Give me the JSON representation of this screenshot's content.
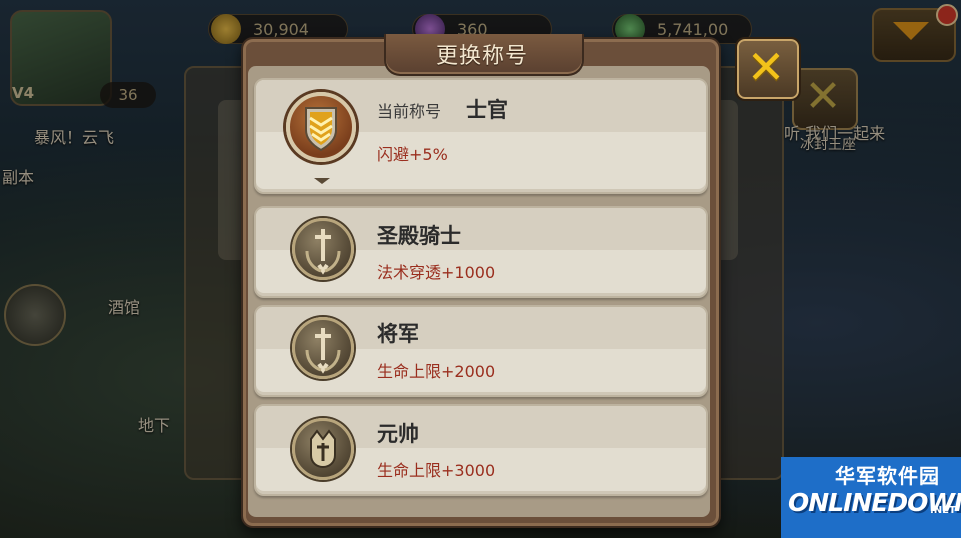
{
  "background": {
    "resources": [
      "30,904",
      "360",
      "5,741,00"
    ],
    "player_level": "V4",
    "player_count": "36",
    "player_name": "暴风！云飞",
    "side_label": "副本",
    "tavern_label": "酒馆",
    "dungeon_label": "地下",
    "banner_text": "听 我们一起来",
    "banner_text2": "冰封王座"
  },
  "dialog": {
    "title": "更换称号",
    "current": {
      "label": "当前称号",
      "name": "士官",
      "bonus": "闪避+5%",
      "emblem_icon": "sergeant-chevron-emblem"
    },
    "titles": [
      {
        "name": "圣殿骑士",
        "bonus": "法术穿透+1000",
        "emblem_icon": "sword-laurel-emblem"
      },
      {
        "name": "将军",
        "bonus": "生命上限+2000",
        "emblem_icon": "sword-laurel-emblem"
      },
      {
        "name": "元帅",
        "bonus": "生命上限+3000",
        "emblem_icon": "helmet-laurel-emblem"
      }
    ]
  },
  "watermark": {
    "cn": "华军软件园",
    "en": "ONLINEDOWN",
    "net": ".NET"
  },
  "colors": {
    "bonus_red": "#9a2e1e",
    "close_gold": "#f2c21a",
    "watermark_blue": "#1e6ec8"
  }
}
